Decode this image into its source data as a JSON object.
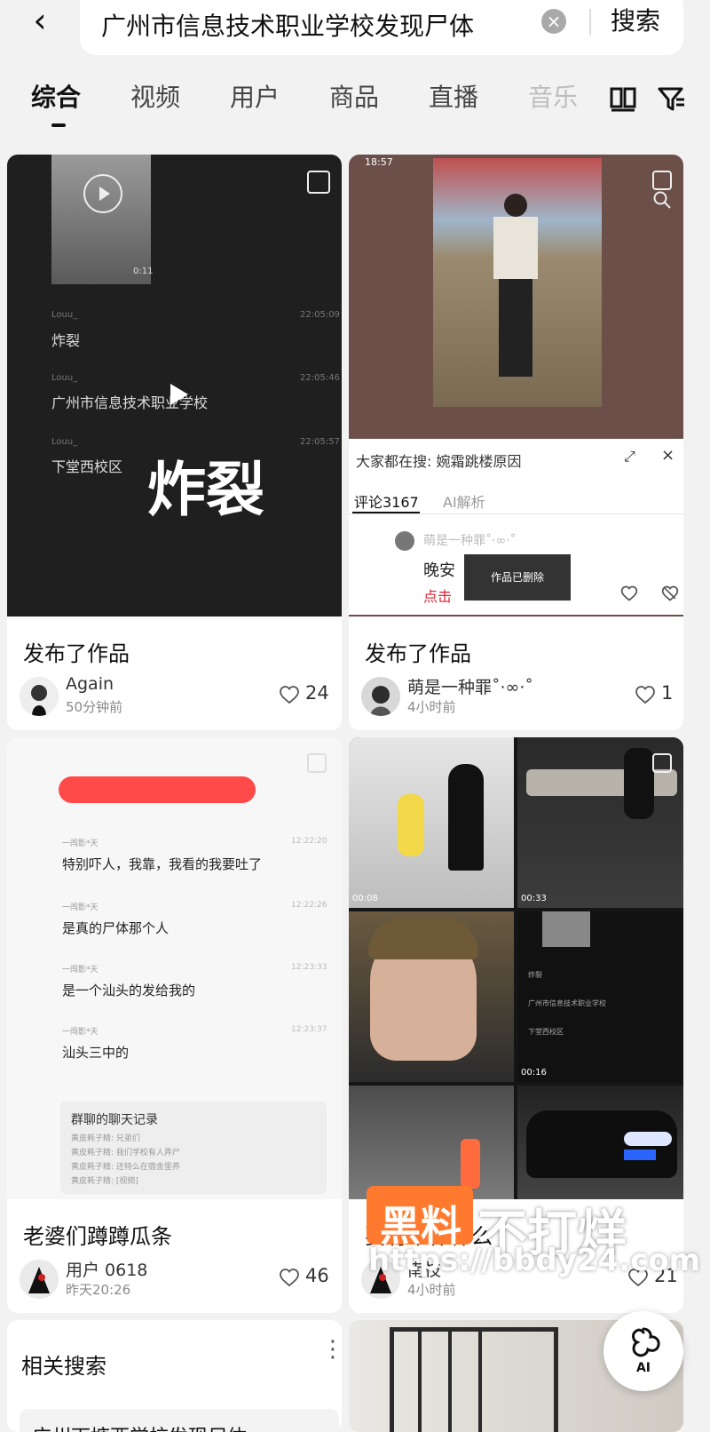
{
  "header": {
    "search_text": "广州市信息技术职业学校发现尸体",
    "search_button": "搜索"
  },
  "tabs": [
    "综合",
    "视频",
    "用户",
    "商品",
    "直播",
    "音乐"
  ],
  "cards": [
    {
      "title": "发布了作品",
      "author": "Again",
      "time": "50分钟前",
      "likes": "24",
      "thumb": {
        "duration": "0:11",
        "lines": [
          "炸裂",
          "广州市信息技术职业学校",
          "下堂西校区"
        ],
        "big": "炸裂",
        "small_name": "Louu_",
        "times": [
          "22:05:09",
          "22:05:46",
          "22:05:57"
        ]
      }
    },
    {
      "title": "发布了作品",
      "author": "萌是一种罪˚·∞·˚",
      "time": "4小时前",
      "likes": "1",
      "thumb": {
        "status_time": "18:57",
        "search_hint": "大家都在搜: 婉霜跳楼原因",
        "comments_tab": "评论3167",
        "ai_tab": "AI解析",
        "comment_user": "萌是一种罪˚·∞·˚",
        "comment_text": "晚安",
        "link_text": "点击",
        "toast": "作品已删除"
      }
    },
    {
      "title": "老婆们蹲蹲瓜条",
      "author": "用户 0618",
      "time": "昨天20:26",
      "likes": "46",
      "thumb": {
        "messages": [
          {
            "name": "一闯影*天",
            "time": "12:22:20",
            "text": "特别吓人，我靠，我看的我要吐了"
          },
          {
            "name": "一闯影*天",
            "time": "12:22:26",
            "text": "是真的尸体那个人"
          },
          {
            "name": "一闯影*天",
            "time": "12:23:33",
            "text": "是一个汕头的发给我的"
          },
          {
            "name": "一闯影*天",
            "time": "12:23:37",
            "text": "汕头三中的"
          }
        ],
        "group_title": "群聊的聊天记录",
        "group_lines": [
          "黄皮耗子精: 兄弟们",
          "黄皮耗子精: 我们学校有人弄尸",
          "黄皮耗子精: 还特么在宿舍里养",
          "黄皮耗子精: [视频]"
        ]
      }
    },
    {
      "title": "要有个作什么",
      "author": "南枝",
      "time": "4小时前",
      "likes": "21",
      "thumb": {
        "durations": [
          "00:08",
          "00:33",
          "00:16"
        ],
        "mini_lines": [
          "炸裂",
          "广州市信息技术职业学校",
          "下堂西校区"
        ]
      }
    }
  ],
  "watermark": {
    "brand1": "黑料",
    "brand2": "不打烊",
    "url": "https://bbdy24.com"
  },
  "related": {
    "title": "相关搜索",
    "more": "⋮",
    "item": "广州下塘西学校发现尸体"
  },
  "ai_button": "AI",
  "colors": {
    "accent": "#111111",
    "watermark_orange": "#ff7a2e"
  },
  "icons": [
    "chevron-left-icon",
    "clear-icon",
    "grid-icon",
    "filter-icon",
    "heart-icon",
    "play-icon",
    "multi-image-icon",
    "ai-icon"
  ]
}
